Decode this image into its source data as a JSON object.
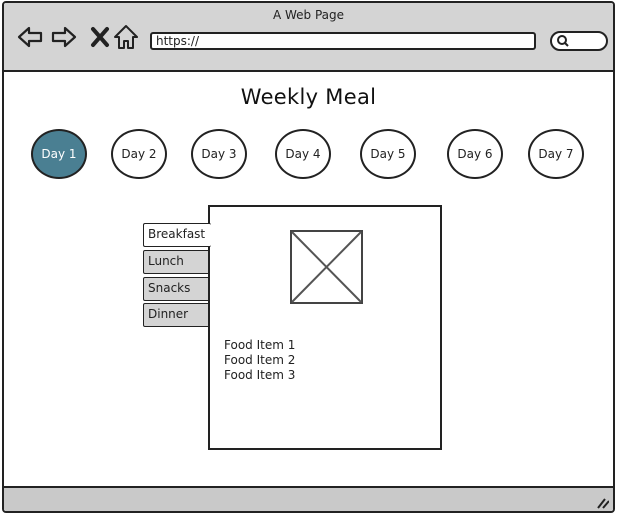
{
  "window": {
    "title": "A Web Page",
    "url": "https://"
  },
  "page": {
    "title": "Weekly Meal"
  },
  "days": [
    {
      "label": "Day 1",
      "active": true
    },
    {
      "label": "Day 2",
      "active": false
    },
    {
      "label": "Day 3",
      "active": false
    },
    {
      "label": "Day 4",
      "active": false
    },
    {
      "label": "Day 5",
      "active": false
    },
    {
      "label": "Day 6",
      "active": false
    },
    {
      "label": "Day 7",
      "active": false
    }
  ],
  "meal_tabs": [
    {
      "label": "Breakfast",
      "active": true
    },
    {
      "label": "Lunch",
      "active": false
    },
    {
      "label": "Snacks",
      "active": false
    },
    {
      "label": "Dinner",
      "active": false
    }
  ],
  "food_items": [
    "Food Item 1",
    "Food Item 2",
    "Food Item 3"
  ],
  "icons": {
    "back": "back-arrow-icon",
    "forward": "forward-arrow-icon",
    "close": "close-icon",
    "home": "home-icon",
    "search": "search-icon",
    "image": "image-placeholder-icon",
    "resize": "resize-grip-icon"
  },
  "colors": {
    "active_day": "#4a7f92",
    "chrome": "#d4d4d4",
    "tab_inactive": "#d4d4d4"
  }
}
